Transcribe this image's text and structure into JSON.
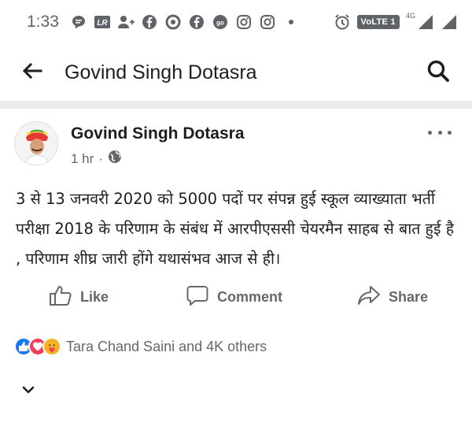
{
  "status_bar": {
    "time": "1:33",
    "carrier_badge": "VoLTE 1",
    "network": "4G",
    "icons": [
      "message-icon",
      "lr-app-icon",
      "person-add-icon",
      "facebook-icon",
      "circle-ring-icon",
      "facebook-icon",
      "go-app-icon",
      "instagram-icon",
      "instagram-icon",
      "dot-icon",
      "alarm-icon",
      "signal-icon",
      "signal-icon"
    ]
  },
  "header": {
    "title": "Govind Singh Dotasra",
    "back_icon": "arrow-left-icon",
    "search_icon": "search-icon"
  },
  "post": {
    "author": "Govind Singh Dotasra",
    "time": "1 hr",
    "separator": "·",
    "privacy_icon": "globe-icon",
    "text": "3 से 13 जनवरी 2020 को 5000 पदों पर संपन्न हुई स्कूल व्याख्याता भर्ती परीक्षा 2018 के परिणाम के संबंध में आरपीएससी चेयरमैन साहब से बात हुई है , परिणाम शीघ्र जारी होंगे यथासंभव आज से ही।",
    "actions": {
      "like": "Like",
      "comment": "Comment",
      "share": "Share"
    },
    "reactions": {
      "types": [
        "like",
        "love",
        "care"
      ],
      "summary": "Tara Chand Saini and 4K others"
    }
  },
  "colors": {
    "text_primary": "#1c1e21",
    "text_secondary": "#65676b",
    "divider": "#e9ebee",
    "like_blue": "#1877f2",
    "love_red": "#f33e58",
    "care_yellow": "#f7b125"
  }
}
